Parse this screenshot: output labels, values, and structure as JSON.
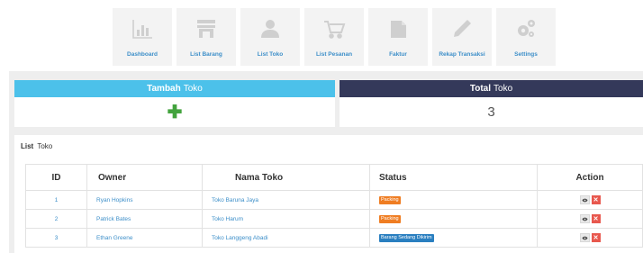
{
  "nav": {
    "items": [
      {
        "label": "Dashboard",
        "icon": "bar-chart-icon"
      },
      {
        "label": "List Barang",
        "icon": "store-icon"
      },
      {
        "label": "List Toko",
        "icon": "user-icon"
      },
      {
        "label": "List Pesanan",
        "icon": "shopping-cart-icon"
      },
      {
        "label": "Faktur",
        "icon": "folder-icon"
      },
      {
        "label": "Rekap Transaksi",
        "icon": "pencil-icon"
      },
      {
        "label": "Settings",
        "icon": "gears-icon"
      }
    ]
  },
  "cards": {
    "add": {
      "bold": "Tambah",
      "rest": "Toko",
      "symbol": "✚"
    },
    "total": {
      "bold": "Total",
      "rest": "Toko",
      "value": "3"
    }
  },
  "list": {
    "title_bold": "List",
    "title_rest": "Toko",
    "columns": [
      "ID",
      "Owner",
      "Nama Toko",
      "Status",
      "Action"
    ],
    "rows": [
      {
        "id": "1",
        "owner": "Ryan Hopkins",
        "nama_toko": "Toko Baruna Jaya",
        "status": "Packing"
      },
      {
        "id": "2",
        "owner": "Patrick Bates",
        "nama_toko": "Toko Harum",
        "status": "Packing"
      },
      {
        "id": "3",
        "owner": "Ethan Greene",
        "nama_toko": "Toko Langgeng Abadi",
        "status": "Barang Sedang Dikirim"
      }
    ],
    "action_delete_symbol": "✕"
  },
  "colors": {
    "accent_blue": "#4cc1ea",
    "dark_header": "#34395a",
    "link_blue": "#3d8fc9",
    "status_packing": "#ef7d22",
    "status_dikirim": "#2a7fc0",
    "delete_red": "#e8584e",
    "add_green": "#43a33e"
  }
}
